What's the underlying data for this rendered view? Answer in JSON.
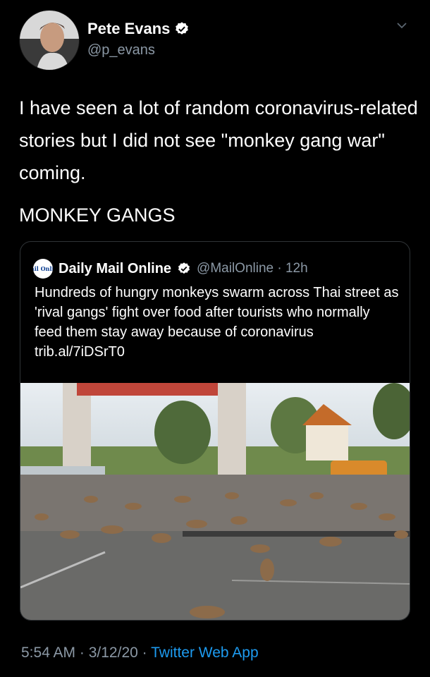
{
  "author": {
    "name": "Pete Evans",
    "handle": "@p_evans"
  },
  "tweet": {
    "text_line1": "I have seen a lot of random coronavirus-related stories but I did not see \"monkey gang war\" coming.",
    "text_line2": "MONKEY GANGS"
  },
  "quote": {
    "logo_text": "Mail Online",
    "name": "Daily Mail Online",
    "handle_time": "@MailOnline · 12h",
    "text": "Hundreds of hungry monkeys swarm across Thai street as 'rival gangs' fight over food after tourists who normally feed them stay away because of coronavirus trib.al/7iDSrT0"
  },
  "footer": {
    "time": "5:54 AM",
    "sep1": " · ",
    "date": "3/12/20",
    "sep2": " · ",
    "app": "Twitter Web App"
  },
  "colors": {
    "background": "#000000",
    "muted": "#8b98a5",
    "accent": "#1d9bf0"
  },
  "icons": [
    "verified-badge-icon",
    "chevron-down-icon"
  ]
}
